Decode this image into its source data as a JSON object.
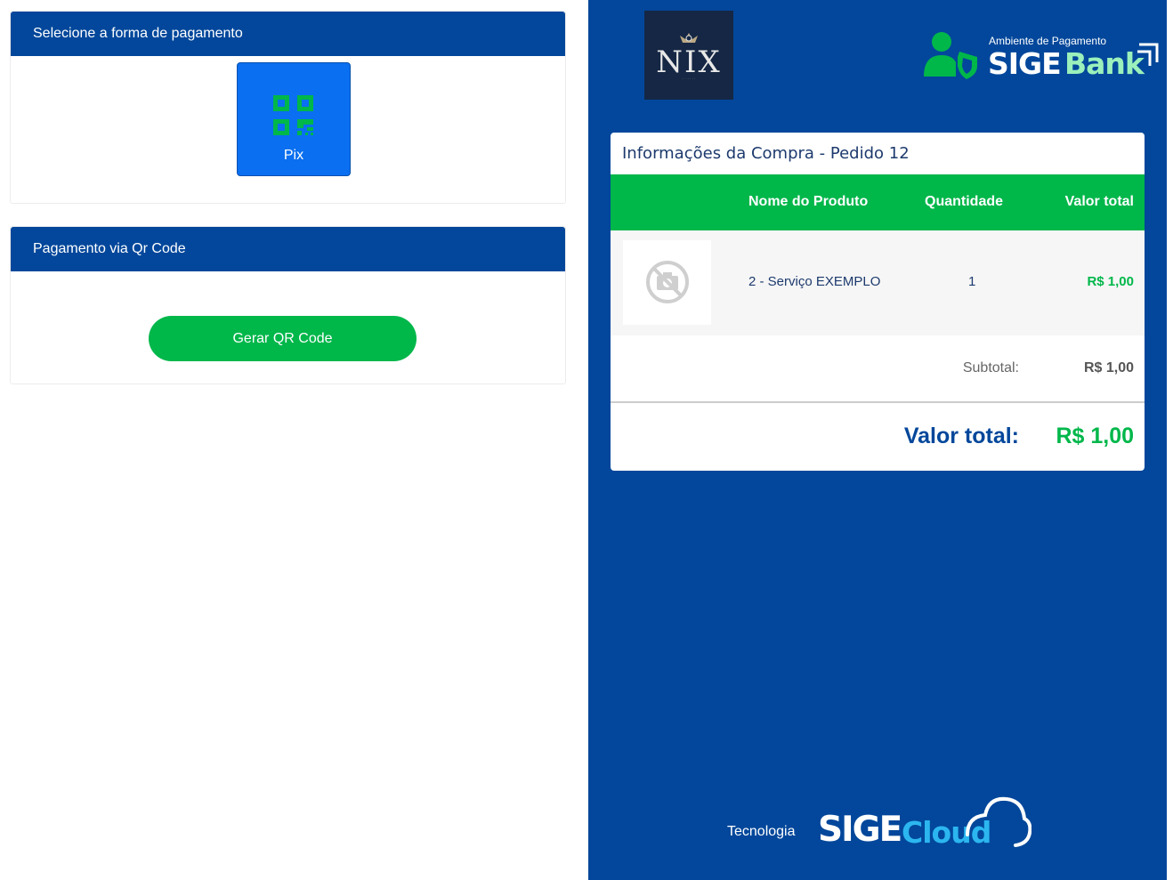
{
  "payment_method": {
    "header": "Selecione a forma de pagamento",
    "options": [
      {
        "label": "Pix",
        "icon": "qr-code-icon"
      }
    ]
  },
  "qr_payment": {
    "header": "Pagamento via Qr Code",
    "button_label": "Gerar QR Code"
  },
  "brand": {
    "store_logo": "NIX",
    "sigebank_caption": "Ambiente de Pagamento",
    "sigebank_sige": "SIGE",
    "sigebank_bank": "Bank"
  },
  "order": {
    "title": "Informações da Compra - Pedido 12",
    "columns": [
      "Nome do Produto",
      "Quantidade",
      "Valor total"
    ],
    "items": [
      {
        "name": "2 - Serviço EXEMPLO",
        "quantity": "1",
        "total": "R$ 1,00"
      }
    ],
    "subtotal_label": "Subtotal:",
    "subtotal_value": "R$ 1,00",
    "total_label": "Valor total:",
    "total_value": "R$ 1,00"
  },
  "footer": {
    "tech_label": "Tecnologia",
    "sigecloud_sige": "SIGE",
    "sigecloud_cloud": "Cloud"
  },
  "colors": {
    "primary_blue": "#02479b",
    "accent_green": "#00b74a",
    "pix_blue": "#0a6ff0"
  }
}
